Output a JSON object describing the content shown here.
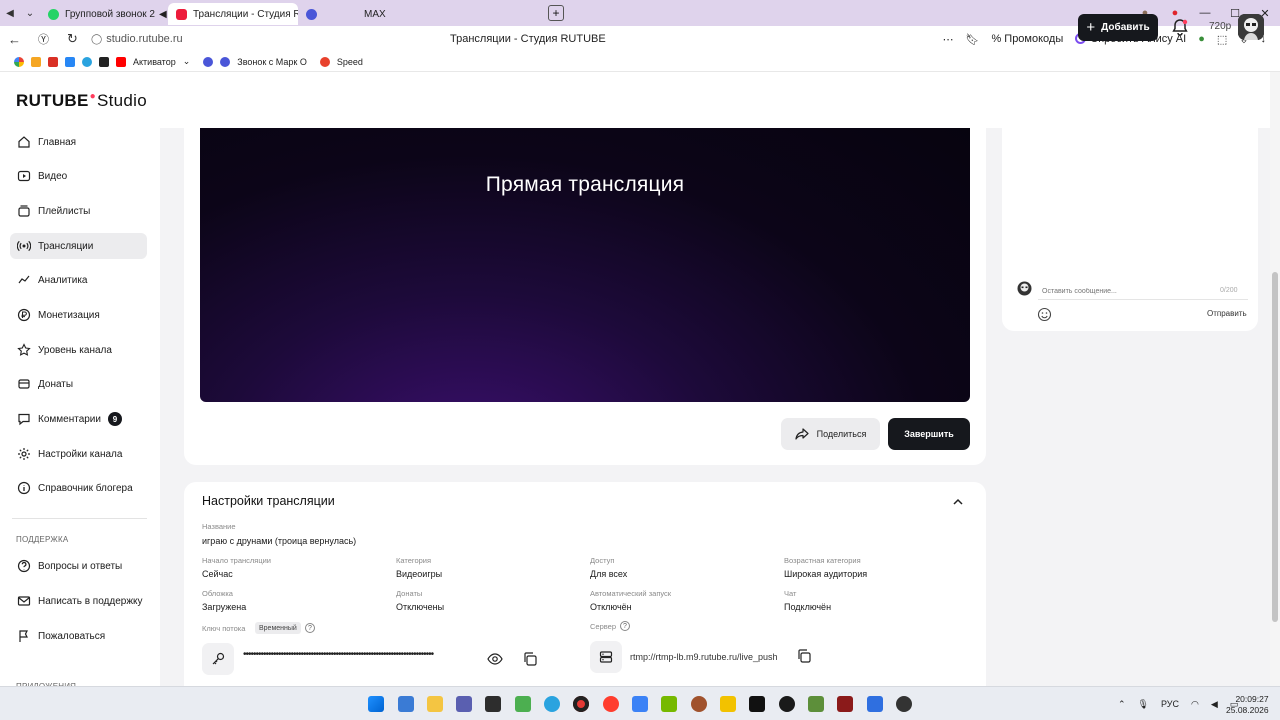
{
  "browser": {
    "tabs": [
      {
        "title": "Групповой звонок 2",
        "active": false
      },
      {
        "title": "Трансляции - Студия R",
        "active": true
      },
      {
        "title": "",
        "active": false
      },
      {
        "title": "MAX",
        "active": false
      }
    ],
    "url": "studio.rutube.ru",
    "page_title": "Трансляции - Студия RUTUBE",
    "promocodes": "Промокоды",
    "ask_alisa": "Спросить Алису AI",
    "bookmarks": [
      "Активатор",
      "Звонок с Марк О",
      "Speed"
    ]
  },
  "header": {
    "logo_main": "RUTUBE",
    "logo_studio": "Studio",
    "add_button": "Добавить",
    "quality": "720p"
  },
  "sidebar": {
    "items": [
      {
        "label": "Главная"
      },
      {
        "label": "Видео"
      },
      {
        "label": "Плейлисты"
      },
      {
        "label": "Трансляции"
      },
      {
        "label": "Аналитика"
      },
      {
        "label": "Монетизация"
      },
      {
        "label": "Уровень канала"
      },
      {
        "label": "Донаты"
      },
      {
        "label": "Комментарии",
        "badge": "9"
      },
      {
        "label": "Настройки канала"
      },
      {
        "label": "Справочник блогера"
      }
    ],
    "support_title": "ПОДДЕРЖКА",
    "support_items": [
      {
        "label": "Вопросы и ответы"
      },
      {
        "label": "Написать в поддержку"
      },
      {
        "label": "Пожаловаться"
      }
    ],
    "apps_title": "ПРИЛОЖЕНИЯ"
  },
  "player": {
    "title": "Прямая трансляция",
    "share_label": "Поделиться",
    "finish_label": "Завершить"
  },
  "chat": {
    "placeholder": "Оставить сообщение...",
    "counter": "0/200",
    "send_label": "Отправить"
  },
  "settings": {
    "title": "Настройки трансляции",
    "name_label": "Название",
    "name_value": "играю с друнами (троица вернулась)",
    "fields": [
      {
        "label": "Начало трансляции",
        "value": "Сейчас"
      },
      {
        "label": "Категория",
        "value": "Видеоигры"
      },
      {
        "label": "Доступ",
        "value": "Для всех"
      },
      {
        "label": "Возрастная категория",
        "value": "Широкая аудитория"
      },
      {
        "label": "Обложка",
        "value": "Загружена"
      },
      {
        "label": "Донаты",
        "value": "Отключены"
      },
      {
        "label": "Автоматический запуск",
        "value": "Отключён"
      },
      {
        "label": "Чат",
        "value": "Подключён"
      }
    ],
    "stream_key_label": "Ключ потока",
    "stream_key_chip": "Временный",
    "stream_key_mask": "••••••••••••••••••••••••••••••••••••••••••••••••••••••••••••••••••••••••••••",
    "server_label": "Сервер",
    "server_url": "rtmp://rtmp-lb.m9.rutube.ru/live_push"
  },
  "taskbar": {
    "lang": "РУС",
    "time": "20:09:27",
    "date": "25.08.2026"
  },
  "colors": {
    "accent_dark": "#16181d",
    "tab_bar": "#dfd3ec",
    "logo_dot": "#ff3b5c"
  }
}
